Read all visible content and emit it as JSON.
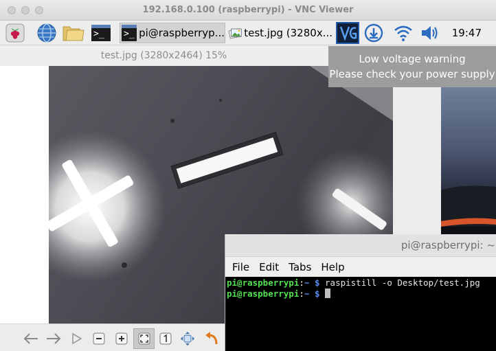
{
  "window": {
    "title": "192.168.0.100 (raspberrypi) - VNC Viewer"
  },
  "taskbar": {
    "tasks": [
      {
        "label": "pi@raspberryp...",
        "icon": "terminal-icon"
      },
      {
        "label": "test.jpg (3280x...",
        "icon": "image-viewer-icon"
      }
    ],
    "clock": "19:47"
  },
  "viewer": {
    "title": "test.jpg (3280x2464) 15%"
  },
  "tooltip": {
    "line1": "Low voltage warning",
    "line2": "Please check your power supply"
  },
  "terminal": {
    "title": "pi@raspberrypi: ~",
    "menu": [
      "File",
      "Edit",
      "Tabs",
      "Help"
    ],
    "lines": [
      {
        "user": "pi@raspberrypi",
        "path": "~",
        "command": "raspistill -o Desktop/test.jpg"
      },
      {
        "user": "pi@raspberrypi",
        "path": "~",
        "command": ""
      }
    ]
  },
  "colors": {
    "prompt_user": "#50e050",
    "prompt_path": "#5b8df0",
    "tooltip_bg": "#9d9d9d",
    "vnc_blue": "#1e5aa8"
  }
}
